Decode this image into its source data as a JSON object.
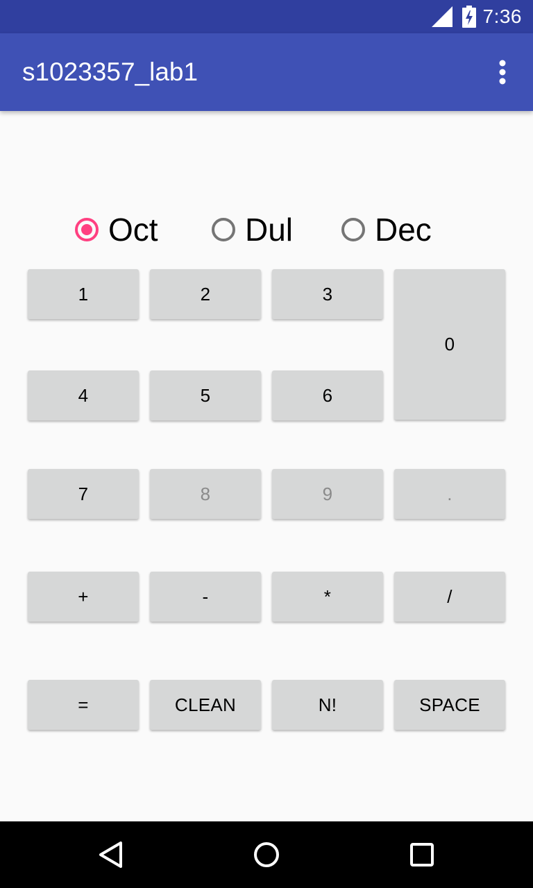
{
  "status_bar": {
    "time": "7:36",
    "icons": [
      "signal-icon",
      "battery-charging-icon"
    ],
    "color": "#303f9f"
  },
  "app_bar": {
    "title": "s1023357_lab1",
    "menu_icon": "overflow-menu-icon",
    "color": "#3f51b5"
  },
  "radio_group": {
    "accent_color": "#ff4081",
    "options": [
      {
        "label": "Oct",
        "checked": true
      },
      {
        "label": "Dul",
        "checked": false
      },
      {
        "label": "Dec",
        "checked": false
      }
    ]
  },
  "keypad": {
    "k1": "1",
    "k2": "2",
    "k3": "3",
    "k0": "0",
    "k4": "4",
    "k5": "5",
    "k6": "6",
    "k7": "7",
    "k8": "8",
    "k9": "9",
    "dot": ".",
    "plus": "+",
    "minus": "-",
    "multiply": "*",
    "divide": "/",
    "equals": "=",
    "clean": "CLEAN",
    "factorial": "N!",
    "space": "SPACE",
    "disabled_keys": [
      "8",
      "9",
      "."
    ]
  },
  "nav_bar": {
    "icons": [
      "back-icon",
      "home-icon",
      "recents-icon"
    ]
  }
}
